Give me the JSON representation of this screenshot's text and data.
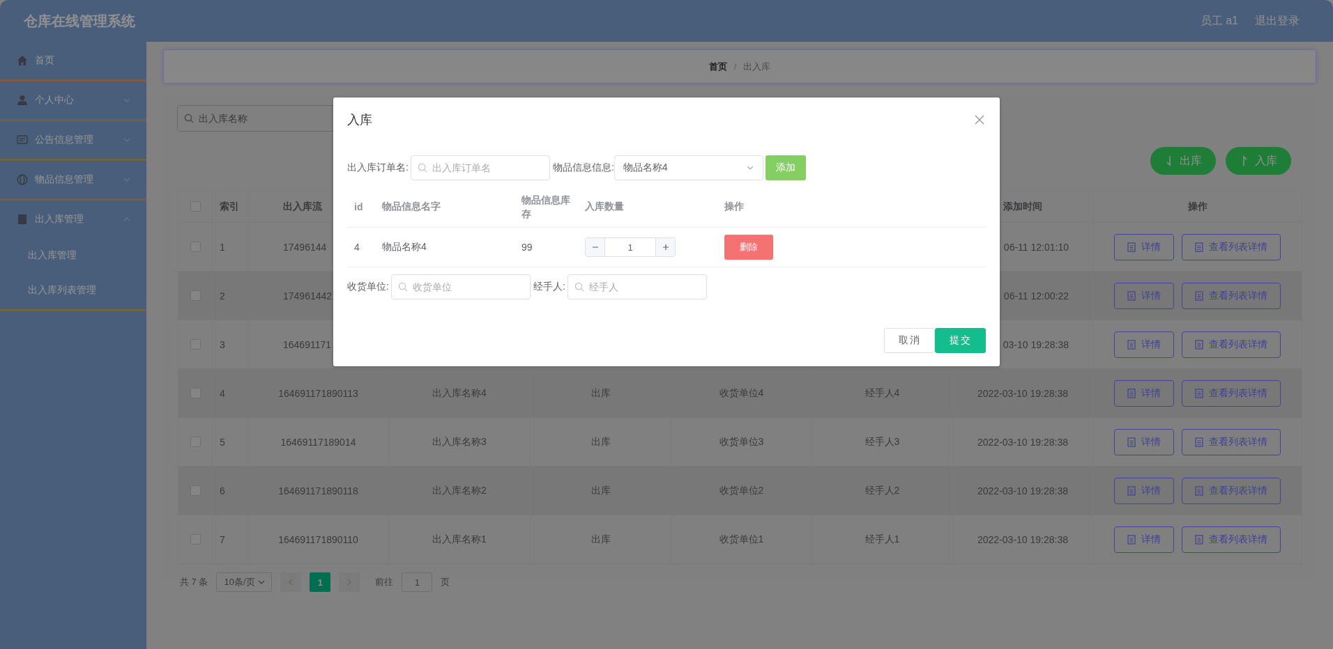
{
  "header": {
    "title": "仓库在线管理系统",
    "user": "员工 a1",
    "logout": "退出登录"
  },
  "sidebar": {
    "items": [
      {
        "label": "首页"
      },
      {
        "label": "个人中心",
        "expanded": false
      },
      {
        "label": "公告信息管理",
        "expanded": false
      },
      {
        "label": "物品信息管理",
        "expanded": false
      },
      {
        "label": "出入库管理",
        "expanded": true,
        "children": [
          {
            "label": "出入库管理"
          },
          {
            "label": "出入库列表管理"
          }
        ]
      }
    ]
  },
  "breadcrumb": {
    "items": [
      "首页",
      "出入库"
    ],
    "separator": "/"
  },
  "search": {
    "placeholder": "出入库名称"
  },
  "actions": [
    {
      "label": "出库",
      "kind": "down"
    },
    {
      "label": "入库",
      "kind": "up"
    }
  ],
  "table": {
    "select_all": {
      "checked": false
    },
    "columns": [
      "索引",
      "出入库流",
      null,
      null,
      null,
      null,
      "添加时间",
      "操作"
    ],
    "rows": [
      {
        "checked": false,
        "cells": [
          "1",
          "17496144",
          null,
          null,
          null,
          null,
          "06-11 12:01:10"
        ],
        "actions": [
          "详情",
          "查看列表详情"
        ]
      },
      {
        "checked": false,
        "cells": [
          "2",
          "174961442",
          null,
          null,
          null,
          null,
          "06-11 12:00:22"
        ],
        "actions": [
          "详情",
          "查看列表详情"
        ]
      },
      {
        "checked": false,
        "cells": [
          "3",
          "164691171",
          null,
          null,
          null,
          null,
          "03-10 19:28:38"
        ],
        "actions": [
          "详情",
          "查看列表详情"
        ]
      },
      {
        "checked": false,
        "cells": [
          "4",
          "164691171890113",
          "出入库名称4",
          "出库",
          "收货单位4",
          "经手人4",
          "2022-03-10 19:28:38"
        ],
        "actions": [
          "详情",
          "查看列表详情"
        ]
      },
      {
        "checked": false,
        "cells": [
          "5",
          "16469117189014",
          "出入库名称3",
          "出库",
          "收货单位3",
          "经手人3",
          "2022-03-10 19:28:38"
        ],
        "actions": [
          "详情",
          "查看列表详情"
        ]
      },
      {
        "checked": false,
        "cells": [
          "6",
          "164691171890118",
          "出入库名称2",
          "出库",
          "收货单位2",
          "经手人2",
          "2022-03-10 19:28:38"
        ],
        "actions": [
          "详情",
          "查看列表详情"
        ]
      },
      {
        "checked": false,
        "cells": [
          "7",
          "164691171890110",
          "出入库名称1",
          "出库",
          "收货单位1",
          "经手人1",
          "2022-03-10 19:28:38"
        ],
        "actions": [
          "详情",
          "查看列表详情"
        ]
      }
    ]
  },
  "pagination": {
    "total": "共 7 条",
    "page_size": "10条/页",
    "prev": {
      "disabled": true
    },
    "pages": [
      {
        "label": "1",
        "selected": true
      }
    ],
    "next": {
      "disabled": true
    },
    "goto_label": "前往",
    "goto_value": "1",
    "goto_suffix": "页"
  },
  "modal": {
    "title": "入库",
    "order_label": "出入库订单名:",
    "order_placeholder": "出入库订单名",
    "item_label": "物品信息信息:",
    "item_value": "物品名称4",
    "add_button": "添加",
    "columns": [
      "id",
      "物品信息名字",
      "物品信息库存",
      "入库数量",
      "操作"
    ],
    "items": [
      {
        "id": "4",
        "name": "物品名称4",
        "stock": "99",
        "quantity": "1",
        "action": "删除"
      }
    ],
    "receiver_label": "收货单位:",
    "receiver_placeholder": "收货单位",
    "handler_label": "经手人:",
    "handler_placeholder": "经手人",
    "buttons": [
      {
        "label": "取消",
        "kind": "default"
      },
      {
        "label": "提交",
        "kind": "primary"
      }
    ]
  }
}
